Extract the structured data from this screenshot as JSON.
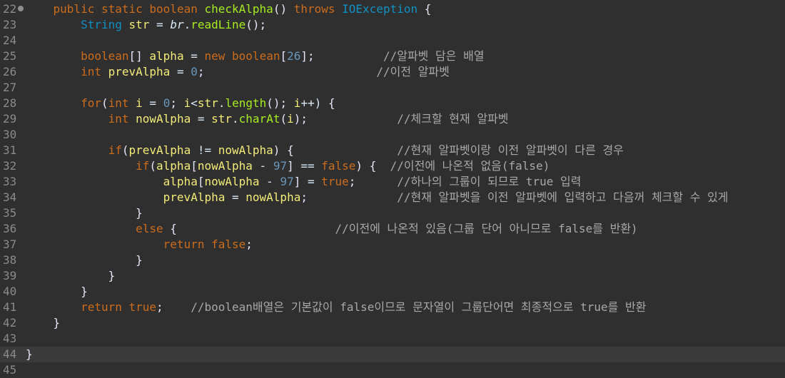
{
  "editor": {
    "lines": [
      {
        "n": "22",
        "fold": true,
        "indent": "    ",
        "tokens": [
          [
            "kw",
            "public"
          ],
          [
            "pl",
            " "
          ],
          [
            "kw",
            "static"
          ],
          [
            "pl",
            " "
          ],
          [
            "kw",
            "boolean"
          ],
          [
            "pl",
            " "
          ],
          [
            "fn",
            "checkAlpha"
          ],
          [
            "pn",
            "()"
          ],
          [
            "pl",
            " "
          ],
          [
            "kw",
            "throws"
          ],
          [
            "pl",
            " "
          ],
          [
            "type",
            "IOException"
          ],
          [
            "pl",
            " "
          ],
          [
            "pn",
            "{"
          ]
        ]
      },
      {
        "n": "23",
        "indent": "        ",
        "tokens": [
          [
            "type",
            "String"
          ],
          [
            "pl",
            " "
          ],
          [
            "var",
            "str"
          ],
          [
            "pl",
            " = "
          ],
          [
            "ital",
            "br"
          ],
          [
            "pl",
            "."
          ],
          [
            "fn",
            "readLine"
          ],
          [
            "pn",
            "();"
          ]
        ]
      },
      {
        "n": "24",
        "indent": "",
        "tokens": []
      },
      {
        "n": "25",
        "indent": "        ",
        "tokens": [
          [
            "kw",
            "boolean"
          ],
          [
            "pn",
            "[]"
          ],
          [
            "pl",
            " "
          ],
          [
            "var",
            "alpha"
          ],
          [
            "pl",
            " = "
          ],
          [
            "kw",
            "new"
          ],
          [
            "pl",
            " "
          ],
          [
            "kw",
            "boolean"
          ],
          [
            "pn",
            "["
          ],
          [
            "num",
            "26"
          ],
          [
            "pn",
            "];"
          ],
          [
            "pl",
            "          "
          ],
          [
            "cm",
            "//알파벳 담은 배열"
          ]
        ]
      },
      {
        "n": "26",
        "indent": "        ",
        "tokens": [
          [
            "kw",
            "int"
          ],
          [
            "pl",
            " "
          ],
          [
            "var",
            "prevAlpha"
          ],
          [
            "pl",
            " = "
          ],
          [
            "num",
            "0"
          ],
          [
            "pn",
            ";"
          ],
          [
            "pl",
            "                         "
          ],
          [
            "cm",
            "//이전 알파벳"
          ]
        ]
      },
      {
        "n": "27",
        "indent": "",
        "tokens": []
      },
      {
        "n": "28",
        "indent": "        ",
        "tokens": [
          [
            "kw",
            "for"
          ],
          [
            "pn",
            "("
          ],
          [
            "kw",
            "int"
          ],
          [
            "pl",
            " "
          ],
          [
            "var",
            "i"
          ],
          [
            "pl",
            " = "
          ],
          [
            "num",
            "0"
          ],
          [
            "pn",
            ";"
          ],
          [
            "pl",
            " "
          ],
          [
            "var",
            "i"
          ],
          [
            "pl",
            "<"
          ],
          [
            "var",
            "str"
          ],
          [
            "pl",
            "."
          ],
          [
            "fn",
            "length"
          ],
          [
            "pn",
            "();"
          ],
          [
            "pl",
            " "
          ],
          [
            "var",
            "i"
          ],
          [
            "pl",
            "++) "
          ],
          [
            "pn",
            "{"
          ]
        ]
      },
      {
        "n": "29",
        "indent": "            ",
        "tokens": [
          [
            "kw",
            "int"
          ],
          [
            "pl",
            " "
          ],
          [
            "var",
            "nowAlpha"
          ],
          [
            "pl",
            " = "
          ],
          [
            "var",
            "str"
          ],
          [
            "pl",
            "."
          ],
          [
            "fn",
            "charAt"
          ],
          [
            "pn",
            "("
          ],
          [
            "var",
            "i"
          ],
          [
            "pn",
            ");"
          ],
          [
            "pl",
            "             "
          ],
          [
            "cm",
            "//체크할 현재 알파벳"
          ]
        ]
      },
      {
        "n": "30",
        "indent": "",
        "tokens": []
      },
      {
        "n": "31",
        "indent": "            ",
        "tokens": [
          [
            "kw",
            "if"
          ],
          [
            "pn",
            "("
          ],
          [
            "var",
            "prevAlpha"
          ],
          [
            "pl",
            " != "
          ],
          [
            "var",
            "nowAlpha"
          ],
          [
            "pn",
            ")"
          ],
          [
            "pl",
            " "
          ],
          [
            "pn",
            "{"
          ],
          [
            "pl",
            "               "
          ],
          [
            "cm",
            "//현재 알파벳이랑 이전 알파벳이 다른 경우"
          ]
        ]
      },
      {
        "n": "32",
        "indent": "                ",
        "tokens": [
          [
            "kw",
            "if"
          ],
          [
            "pn",
            "("
          ],
          [
            "var",
            "alpha"
          ],
          [
            "pn",
            "["
          ],
          [
            "var",
            "nowAlpha"
          ],
          [
            "pl",
            " - "
          ],
          [
            "num",
            "97"
          ],
          [
            "pn",
            "]"
          ],
          [
            "pl",
            " == "
          ],
          [
            "kw",
            "false"
          ],
          [
            "pn",
            ")"
          ],
          [
            "pl",
            " "
          ],
          [
            "pn",
            "{"
          ],
          [
            "pl",
            "  "
          ],
          [
            "cm",
            "//이전에 나온적 없음(false)"
          ]
        ]
      },
      {
        "n": "33",
        "indent": "                    ",
        "tokens": [
          [
            "var",
            "alpha"
          ],
          [
            "pn",
            "["
          ],
          [
            "var",
            "nowAlpha"
          ],
          [
            "pl",
            " - "
          ],
          [
            "num",
            "97"
          ],
          [
            "pn",
            "]"
          ],
          [
            "pl",
            " = "
          ],
          [
            "kw",
            "true"
          ],
          [
            "pn",
            ";"
          ],
          [
            "pl",
            "      "
          ],
          [
            "cm",
            "//하나의 그룹이 되므로 true 입력"
          ]
        ]
      },
      {
        "n": "34",
        "indent": "                    ",
        "tokens": [
          [
            "var",
            "prevAlpha"
          ],
          [
            "pl",
            " = "
          ],
          [
            "var",
            "nowAlpha"
          ],
          [
            "pn",
            ";"
          ],
          [
            "pl",
            "             "
          ],
          [
            "cm",
            "//현재 알파벳을 이전 알파벳에 입력하고 다음꺼 체크할 수 있게"
          ]
        ]
      },
      {
        "n": "35",
        "indent": "                ",
        "tokens": [
          [
            "pn",
            "}"
          ]
        ]
      },
      {
        "n": "36",
        "indent": "                ",
        "tokens": [
          [
            "kw",
            "else"
          ],
          [
            "pl",
            " "
          ],
          [
            "pn",
            "{"
          ],
          [
            "pl",
            "                       "
          ],
          [
            "cm",
            "//이전에 나온적 있음(그룹 단어 아니므로 false를 반환)"
          ]
        ]
      },
      {
        "n": "37",
        "indent": "                    ",
        "tokens": [
          [
            "kw",
            "return"
          ],
          [
            "pl",
            " "
          ],
          [
            "kw",
            "false"
          ],
          [
            "pn",
            ";"
          ]
        ]
      },
      {
        "n": "38",
        "indent": "                ",
        "tokens": [
          [
            "pn",
            "}"
          ]
        ]
      },
      {
        "n": "39",
        "indent": "            ",
        "tokens": [
          [
            "pn",
            "}"
          ]
        ]
      },
      {
        "n": "40",
        "indent": "        ",
        "tokens": [
          [
            "pn",
            "}"
          ]
        ]
      },
      {
        "n": "41",
        "indent": "        ",
        "tokens": [
          [
            "kw",
            "return"
          ],
          [
            "pl",
            " "
          ],
          [
            "kw",
            "true"
          ],
          [
            "pn",
            ";"
          ],
          [
            "pl",
            "    "
          ],
          [
            "cm",
            "//boolean배열은 기본값이 false이므로 문자열이 그룹단어면 최종적으로 true를 반환"
          ]
        ]
      },
      {
        "n": "42",
        "indent": "    ",
        "tokens": [
          [
            "pn",
            "}"
          ]
        ]
      },
      {
        "n": "43",
        "indent": "",
        "tokens": []
      },
      {
        "n": "44",
        "indent": "",
        "current": true,
        "tokens": [
          [
            "pn",
            "}"
          ]
        ]
      },
      {
        "n": "45",
        "indent": "",
        "tokens": []
      }
    ]
  },
  "colors": {
    "background": "#2f2f2f",
    "current_line": "#3a3a3a",
    "keyword": "#cc6c1d",
    "type": "#1290c3",
    "method": "#a7ec21",
    "variable": "#f3ec79",
    "number": "#6897bb",
    "comment": "#a8a8a8"
  }
}
